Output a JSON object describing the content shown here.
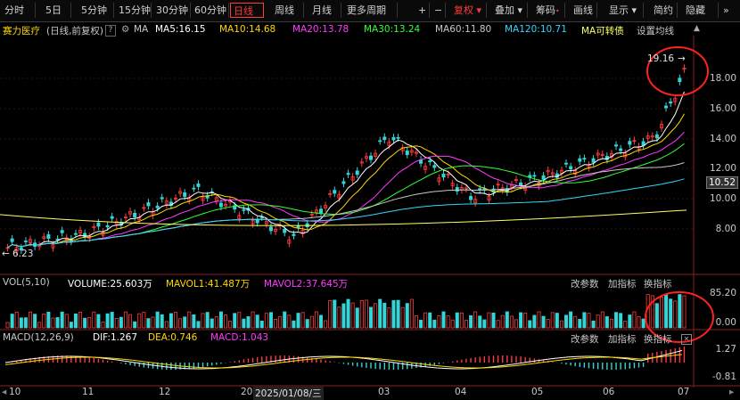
{
  "toolbar": {
    "periods": [
      "分时",
      "5日",
      "5分钟",
      "15分钟",
      "30分钟",
      "60分钟",
      "日线",
      "周线",
      "月线",
      "更多周期"
    ],
    "active": "日线",
    "tools": [
      "+",
      "−",
      "复权",
      "叠加",
      "筹码",
      "画线",
      "显示",
      "简约",
      "隐藏"
    ]
  },
  "info": {
    "stock": "赛力医疗",
    "mode": "(日线,前复权)",
    "ma_label": "MA",
    "ma5": "MA5:16.15",
    "ma10": "MA10:14.68",
    "ma20": "MA20:13.78",
    "ma30": "MA30:13.24",
    "ma60": "MA60:11.80",
    "ma120": "MA120:10.71",
    "convert": "MA可转债",
    "settings": "设置均线"
  },
  "price_axis": {
    "ticks": [
      "18.00",
      "16.00",
      "14.00",
      "12.00",
      "10.00",
      "8.00"
    ],
    "current": "10.52",
    "high_label": "19.16",
    "low_label": "6.23"
  },
  "volume": {
    "label": "VOL(5,10)",
    "volume": "VOLUME:25.603万",
    "mavol1": "MAVOL1:41.487万",
    "mavol2": "MAVOL2:37.645万",
    "ticks": [
      "85.20",
      "0.00"
    ]
  },
  "macd": {
    "label": "MACD(12,26,9)",
    "dif": "DIF:1.267",
    "dea": "DEA:0.746",
    "macd": "MACD:1.043",
    "ticks": [
      "1.27",
      "-0.81"
    ]
  },
  "pane_buttons": [
    "改参数",
    "加指标",
    "换指标"
  ],
  "x_axis": [
    "10",
    "11",
    "12",
    "20",
    "2025/01/08/三",
    "03",
    "04",
    "05",
    "06",
    "07"
  ],
  "colors": {
    "up": "#ff3b3b",
    "down": "#33d6d6",
    "ma5": "#ffffff",
    "ma10": "#ffd800",
    "ma20": "#ff3bff",
    "ma30": "#33ff33",
    "ma60": "#c8c8c8",
    "ma120": "#33d6ff",
    "ma250": "#ffff66"
  }
}
